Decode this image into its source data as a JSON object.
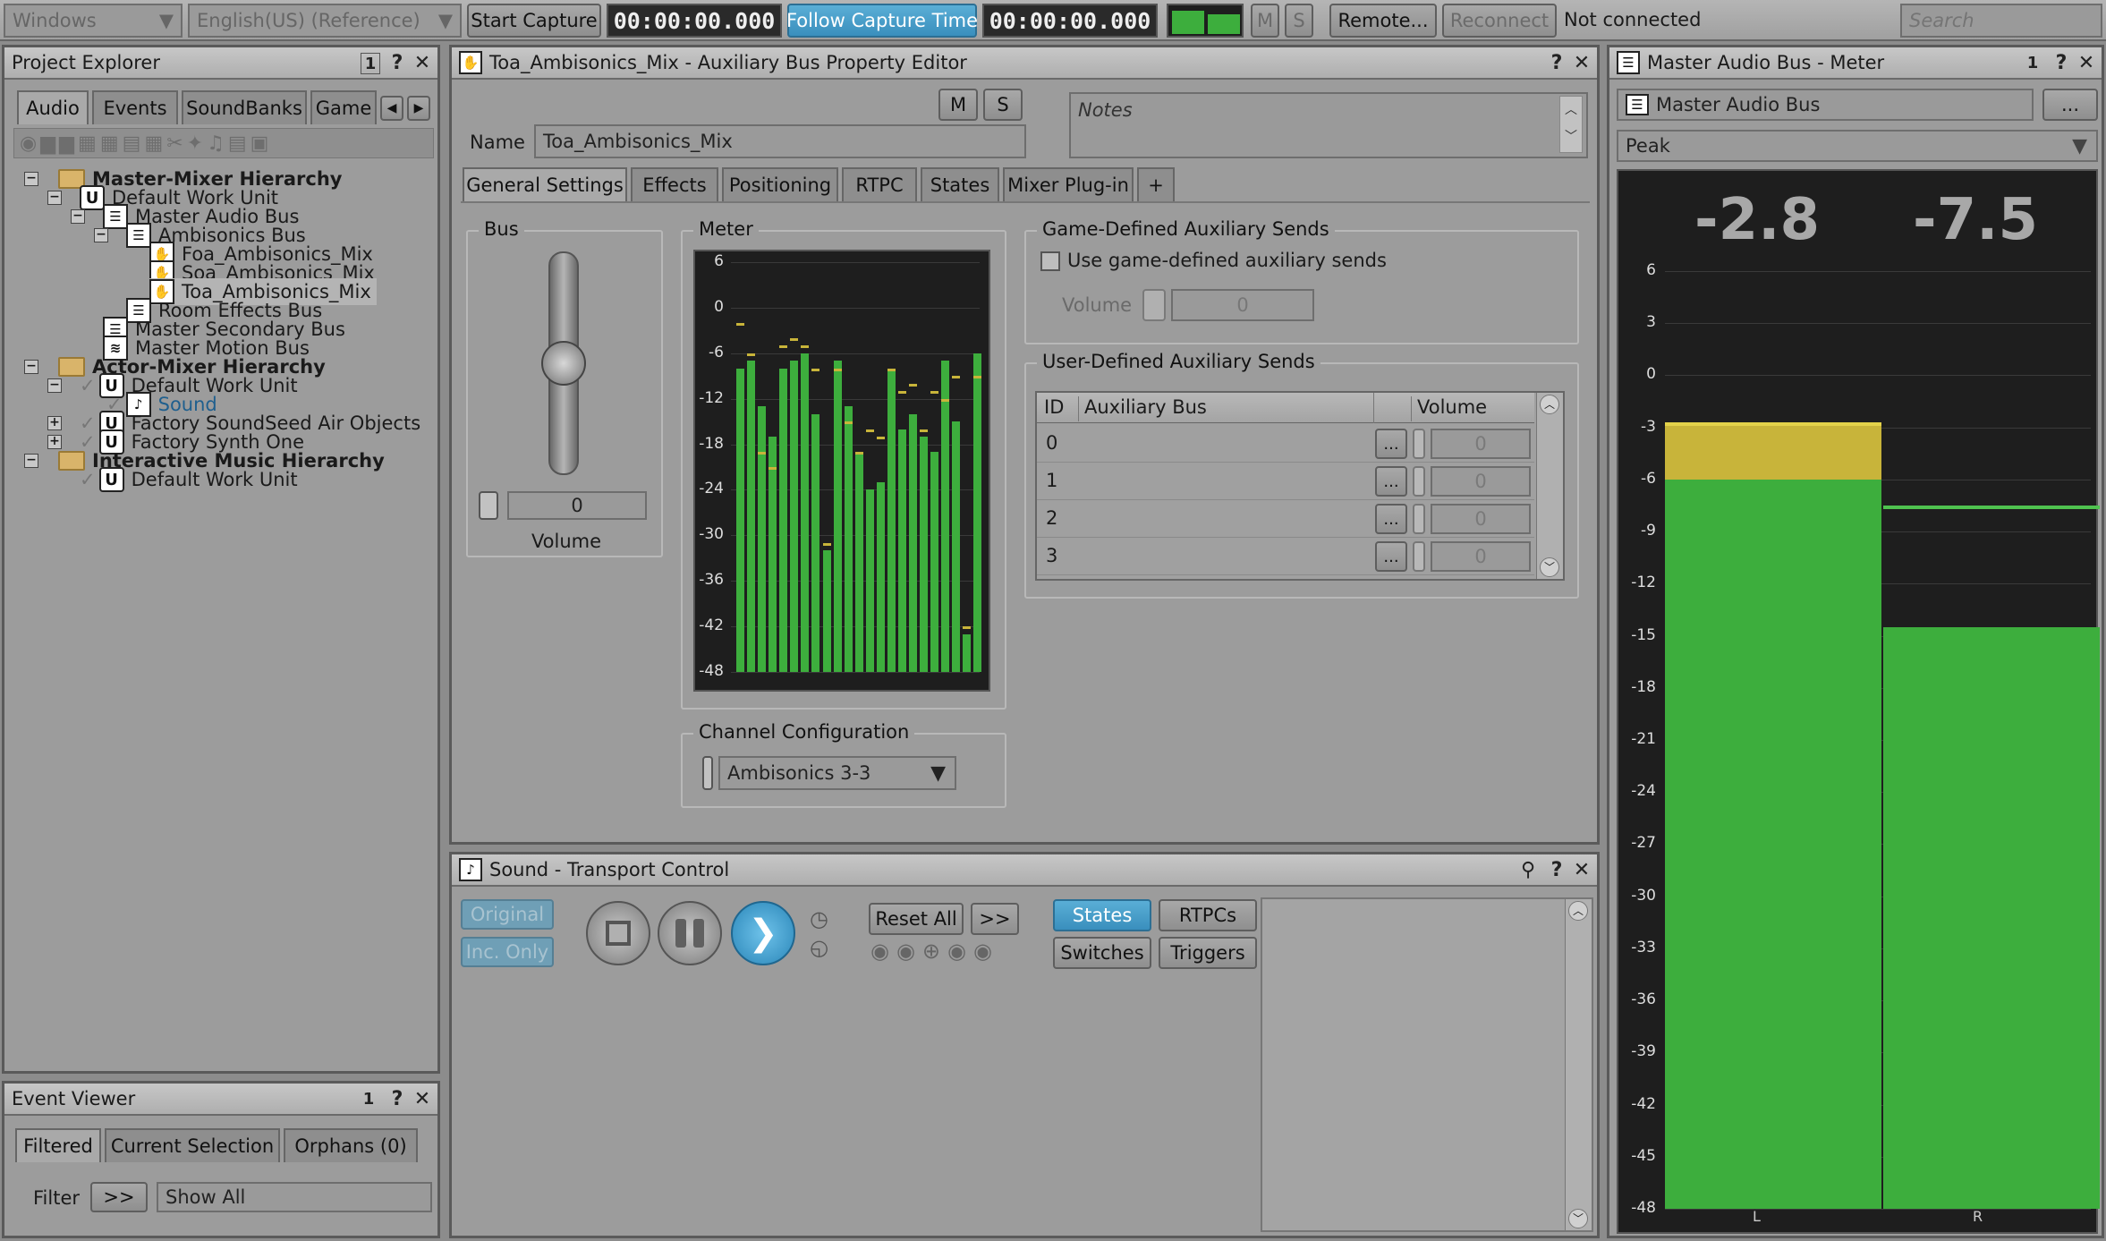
{
  "toolbar": {
    "layout_select": "Windows",
    "language_select": "English(US) (Reference)",
    "start_capture": "Start Capture",
    "capture_time": "00:00:00.000",
    "follow_capture": "Follow Capture Time",
    "follow_time": "00:00:00.000",
    "mute": "M",
    "solo": "S",
    "remote": "Remote...",
    "reconnect": "Reconnect",
    "status": "Not connected",
    "search_placeholder": "Search"
  },
  "project_explorer": {
    "title": "Project Explorer",
    "badge": "1",
    "help": "?",
    "tabs": [
      "Audio",
      "Events",
      "SoundBanks",
      "Game"
    ],
    "tree": [
      {
        "label": "Master-Mixer Hierarchy",
        "icon": "folder-icon",
        "bold": true
      },
      {
        "label": "Default Work Unit",
        "icon": "work-unit-icon"
      },
      {
        "label": "Master Audio Bus",
        "icon": "bus-icon"
      },
      {
        "label": "Ambisonics Bus",
        "icon": "bus-icon"
      },
      {
        "label": "Foa_Ambisonics_Mix",
        "icon": "aux-bus-icon"
      },
      {
        "label": "Soa_Ambisonics_Mix",
        "icon": "aux-bus-icon"
      },
      {
        "label": "Toa_Ambisonics_Mix",
        "icon": "aux-bus-icon",
        "selected": true
      },
      {
        "label": "Room Effects Bus",
        "icon": "bus-icon"
      },
      {
        "label": "Master Secondary Bus",
        "icon": "bus-icon"
      },
      {
        "label": "Master Motion Bus",
        "icon": "motion-bus-icon"
      },
      {
        "label": "Actor-Mixer Hierarchy",
        "icon": "folder-icon",
        "bold": true
      },
      {
        "label": "Default Work Unit",
        "icon": "work-unit-icon"
      },
      {
        "label": "Sound",
        "icon": "sound-icon",
        "link": true
      },
      {
        "label": "Factory SoundSeed Air Objects",
        "icon": "work-unit-icon"
      },
      {
        "label": "Factory Synth One",
        "icon": "work-unit-icon"
      },
      {
        "label": "Interactive Music Hierarchy",
        "icon": "folder-icon",
        "bold": true
      },
      {
        "label": "Default Work Unit",
        "icon": "work-unit-icon"
      }
    ]
  },
  "event_viewer": {
    "title": "Event Viewer",
    "badge": "1",
    "help": "?",
    "tabs": [
      "Filtered",
      "Current Selection",
      "Orphans (0)"
    ],
    "filter_label": "Filter",
    "filter_button": ">>",
    "filter_value": "Show All"
  },
  "property_editor": {
    "title": "Toa_Ambisonics_Mix - Auxiliary Bus Property Editor",
    "help": "?",
    "mute": "M",
    "solo": "S",
    "name_label": "Name",
    "name_value": "Toa_Ambisonics_Mix",
    "notes_placeholder": "Notes",
    "tabs": [
      "General Settings",
      "Effects",
      "Positioning",
      "RTPC",
      "States",
      "Mixer Plug-in",
      "+"
    ],
    "bus_group": "Bus",
    "volume_value": "0",
    "volume_label": "Volume",
    "volume_level": 0.5,
    "meter_group": "Meter",
    "meter_ticks": [
      "6",
      "0",
      "-6",
      "-12",
      "-18",
      "-24",
      "-30",
      "-36",
      "-42",
      "-48"
    ],
    "meter_levels": [
      -8,
      -7,
      -13,
      -17,
      -8,
      -7,
      -6,
      -14,
      -32,
      -7,
      -13,
      -19,
      -24,
      -23,
      -8,
      -16,
      -14,
      -17,
      -19,
      -7,
      -15,
      -43,
      -6
    ],
    "meter_peaks": [
      -2,
      -6,
      -19,
      -21,
      -5,
      -4,
      -5,
      -8,
      -31,
      -8,
      -15,
      -19,
      -16,
      -17,
      -8,
      -11,
      -10,
      -16,
      -11,
      -12,
      -9,
      -42,
      -9
    ],
    "channel_group": "Channel Configuration",
    "channel_value": "Ambisonics 3-3",
    "game_sends_group": "Game-Defined Auxiliary Sends",
    "game_sends_checkbox": "Use game-defined auxiliary sends",
    "game_volume_label": "Volume",
    "game_volume_value": "0",
    "user_sends_group": "User-Defined Auxiliary Sends",
    "sends_columns": [
      "ID",
      "Auxiliary Bus",
      "Volume"
    ],
    "sends_rows": [
      {
        "id": "0",
        "bus": "",
        "browse": "...",
        "volume": "0"
      },
      {
        "id": "1",
        "bus": "",
        "browse": "...",
        "volume": "0"
      },
      {
        "id": "2",
        "bus": "",
        "browse": "...",
        "volume": "0"
      },
      {
        "id": "3",
        "bus": "",
        "browse": "...",
        "volume": "0"
      }
    ]
  },
  "transport": {
    "title": "Sound - Transport Control",
    "help": "?",
    "original": "Original",
    "inc_only": "Inc. Only",
    "reset_all": "Reset All",
    "more": ">>",
    "states": "States",
    "rtpcs": "RTPCs",
    "switches": "Switches",
    "triggers": "Triggers"
  },
  "master_meter": {
    "title": "Master Audio Bus - Meter",
    "badge": "1",
    "help": "?",
    "bus_name": "Master Audio Bus",
    "browse": "...",
    "mode": "Peak",
    "peak_left": "-2.8",
    "peak_right": "-7.5",
    "ticks": [
      "6",
      "3",
      "0",
      "-3",
      "-6",
      "-9",
      "-12",
      "-15",
      "-18",
      "-21",
      "-24",
      "-27",
      "-30",
      "-33",
      "-36",
      "-39",
      "-42",
      "-45",
      "-48"
    ],
    "channel_left": "L",
    "channel_right": "R",
    "left_level": -6.0,
    "left_peak": -2.8,
    "left_hold": -3.0,
    "right_level": -14.5,
    "right_hold": -7.5
  },
  "colors": {
    "meter_green": "#3dae3d",
    "meter_yellow": "#c8b43a",
    "accent_blue": "#3a8fbd"
  }
}
